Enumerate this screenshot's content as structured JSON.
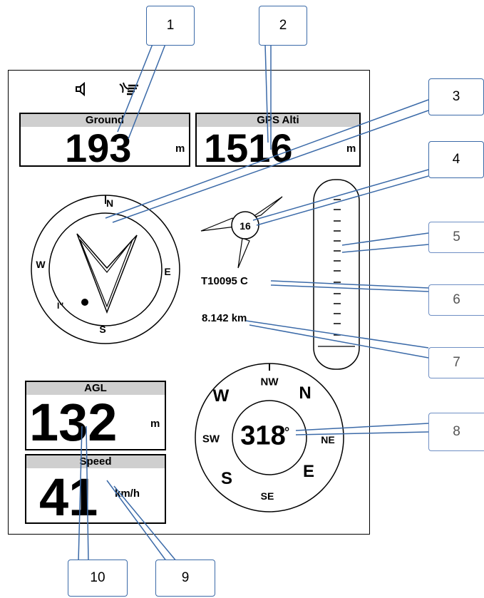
{
  "status_icons": [
    "speaker-icon",
    "gps-signal-icon"
  ],
  "ground": {
    "label": "Ground",
    "value": "193",
    "unit": "m"
  },
  "gps_alti": {
    "label": "GPS Alti",
    "value": "1516",
    "unit": "m"
  },
  "agl": {
    "label": "AGL",
    "value": "132",
    "unit": "m"
  },
  "speed": {
    "label": "Speed",
    "value": "41",
    "unit": "km/h"
  },
  "wind_compass": {
    "n": "N",
    "s": "S",
    "e": "E",
    "w": "W",
    "marker": "I''"
  },
  "wind_speed": "16",
  "waypoint": "T10095 C",
  "distance": "8.142 km",
  "heading": {
    "value": "318",
    "degree": "°",
    "n": "N",
    "nw": "NW",
    "ne": "NE",
    "w": "W",
    "sw": "SW",
    "s": "S",
    "se": "SE",
    "e": "E"
  },
  "callouts": [
    "1",
    "2",
    "3",
    "4",
    "5",
    "6",
    "7",
    "8",
    "9",
    "10"
  ],
  "colors": {
    "callout_border": "#3b6aa8",
    "header_gray": "#cfcfcf"
  }
}
